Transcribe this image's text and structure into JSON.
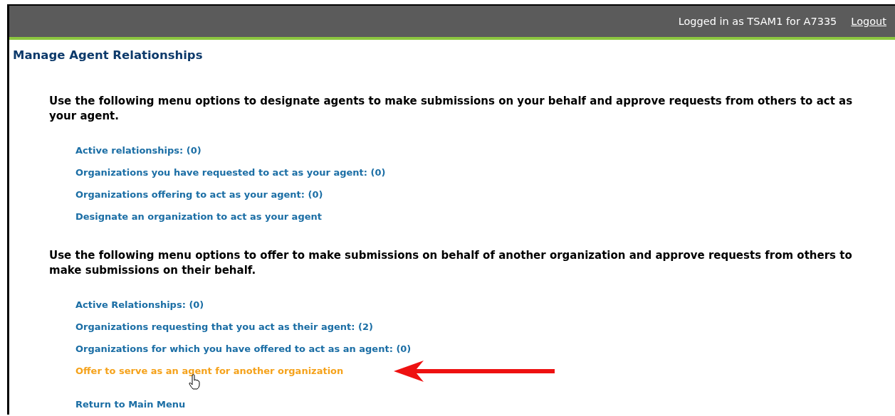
{
  "header": {
    "login_text": "Logged in as TSAM1 for A7335",
    "logout": "Logout"
  },
  "title": "Manage Agent Relationships",
  "sections": [
    {
      "intro": "Use the following menu options to designate agents to make submissions on your behalf and approve requests from others to act as your agent.",
      "links": [
        {
          "label": "Active relationships: (0)",
          "hovered": false
        },
        {
          "label": "Organizations you have requested to act as your agent: (0)",
          "hovered": false
        },
        {
          "label": "Organizations offering to act as your agent: (0)",
          "hovered": false
        },
        {
          "label": "Designate an organization to act as your agent",
          "hovered": false
        }
      ]
    },
    {
      "intro": "Use the following menu options to offer to make submissions on behalf of another organization and approve requests from others to make submissions on their behalf.",
      "links": [
        {
          "label": "Active Relationships: (0)",
          "hovered": false
        },
        {
          "label": "Organizations requesting that you act as their agent: (2)",
          "hovered": false
        },
        {
          "label": "Organizations for which you have offered to act as an agent: (0)",
          "hovered": false
        },
        {
          "label": "Offer to serve as an agent for another organization",
          "hovered": true
        }
      ]
    }
  ],
  "return_link": "Return to Main Menu"
}
